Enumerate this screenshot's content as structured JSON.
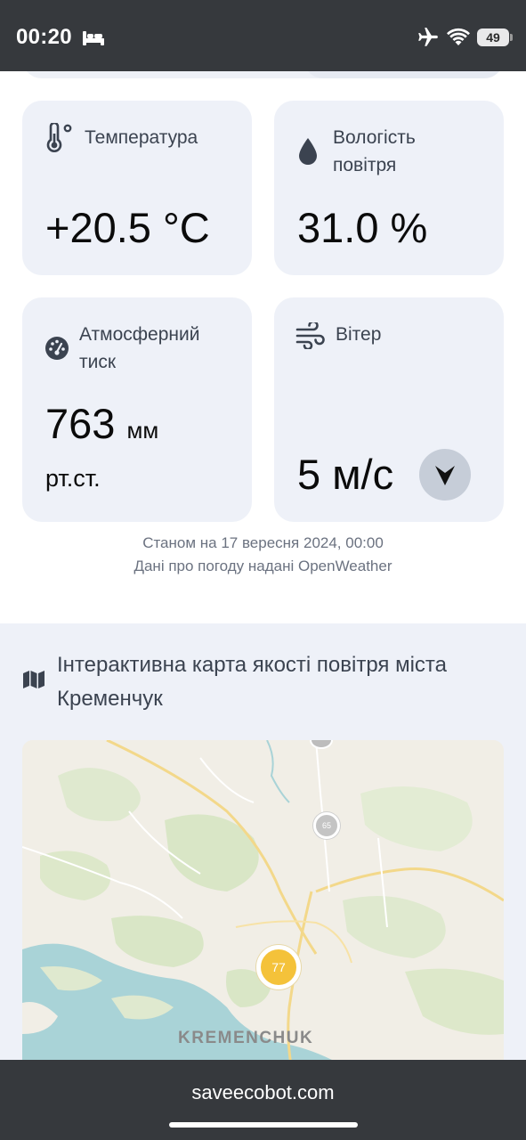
{
  "status_bar": {
    "time": "00:20",
    "battery": "49",
    "icons": [
      "bed-icon",
      "airplane-icon",
      "wifi-icon",
      "battery-icon"
    ]
  },
  "weather": {
    "temperature": {
      "label": "Температура",
      "value": "+20.5 °C",
      "icon": "thermometer-icon"
    },
    "humidity": {
      "label": "Вологість повітря",
      "value": "31.0 %",
      "icon": "droplet-icon"
    },
    "pressure": {
      "label": "Атмосферний тиск",
      "value": "763",
      "unit": "мм",
      "unit_line2": "рт.ст.",
      "icon": "gauge-icon"
    },
    "wind": {
      "label": "Вітер",
      "value": "5 м/с",
      "icon": "wind-icon",
      "direction_icon": "arrow-down-icon"
    },
    "as_of": "Станом на 17 вересня 2024, 00:00",
    "provider": "Дані про погоду надані OpenWeather"
  },
  "map_section": {
    "title": "Інтерактивна карта якості повітря міста Кременчук",
    "icon": "map-icon",
    "city_label": "KREMENCHUK",
    "markers": [
      {
        "value": "77",
        "color": "#f4c23a"
      },
      {
        "value": "65",
        "color": "#bdbdbd"
      }
    ]
  },
  "browser": {
    "url": "saveecobot.com"
  }
}
